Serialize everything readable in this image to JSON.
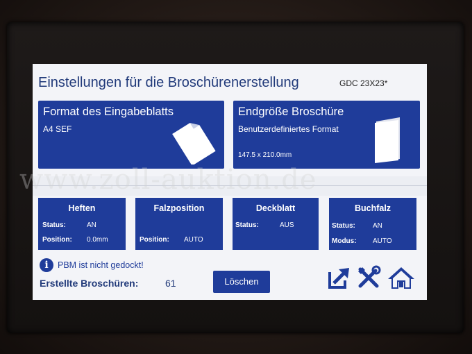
{
  "header": {
    "title": "Einstellungen für die Broschürenerstellung",
    "model": "GDC 23X23*"
  },
  "format_card": {
    "title": "Format des Eingabeblatts",
    "value": "A4 SEF",
    "icon": "paper-sheet-icon"
  },
  "size_card": {
    "title": "Endgröße Broschüre",
    "value": "Benutzerdefiniertes Format",
    "dimensions": "147.5 x 210.0mm",
    "icon": "booklet-icon"
  },
  "settings": {
    "heften": {
      "title": "Heften",
      "status_label": "Status:",
      "status_value": "AN",
      "position_label": "Position:",
      "position_value": "0.0mm"
    },
    "falzposition": {
      "title": "Falzposition",
      "position_label": "Position:",
      "position_value": "AUTO"
    },
    "deckblatt": {
      "title": "Deckblatt",
      "status_label": "Status:",
      "status_value": "AUS"
    },
    "buchfalz": {
      "title": "Buchfalz",
      "status_label": "Status:",
      "status_value": "AN",
      "modus_label": "Modus:",
      "modus_value": "AUTO"
    }
  },
  "info": {
    "message": "PBM ist nicht gedockt!",
    "icon": "info-icon"
  },
  "counter": {
    "label": "Erstellte Broschüren:",
    "value": "61"
  },
  "actions": {
    "loeschen_label": "Löschen",
    "icons": [
      "export-icon",
      "tools-icon",
      "home-icon"
    ]
  },
  "watermark": "www.zoll-auktion.de",
  "colors": {
    "accent": "#1f3c9a",
    "screen_bg": "#f3f4f8",
    "text_dark": "#213a7a"
  }
}
